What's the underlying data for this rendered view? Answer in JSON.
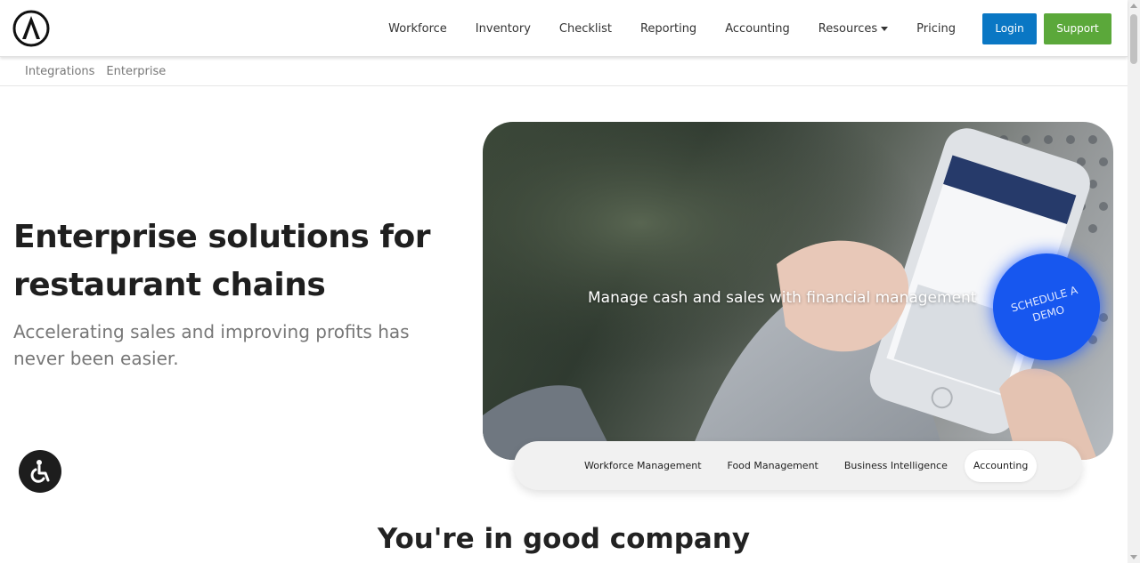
{
  "nav": {
    "items": [
      "Workforce",
      "Inventory",
      "Checklist",
      "Reporting",
      "Accounting",
      "Resources",
      "Pricing"
    ],
    "login_label": "Login",
    "support_label": "Support"
  },
  "subnav": {
    "items": [
      "Integrations",
      "Enterprise"
    ]
  },
  "hero": {
    "title": "Enterprise solutions for restaurant chains",
    "subtitle": "Accelerating sales and improving profits has never been easier."
  },
  "card": {
    "caption": "Manage cash and sales with financial management",
    "demo_label": "SCHEDULE A DEMO"
  },
  "tabs": {
    "items": [
      "Workforce Management",
      "Food Management",
      "Business Intelligence",
      "Accounting"
    ],
    "active": "Accounting"
  },
  "section": {
    "title": "You're in good company"
  },
  "colors": {
    "login": "#0a77c4",
    "support": "#5ba83a",
    "demo_badge": "#1757ef"
  },
  "icons": {
    "logo": "logo-icon",
    "accessibility": "accessibility-icon",
    "resources_dropdown": "caret-down-icon"
  }
}
